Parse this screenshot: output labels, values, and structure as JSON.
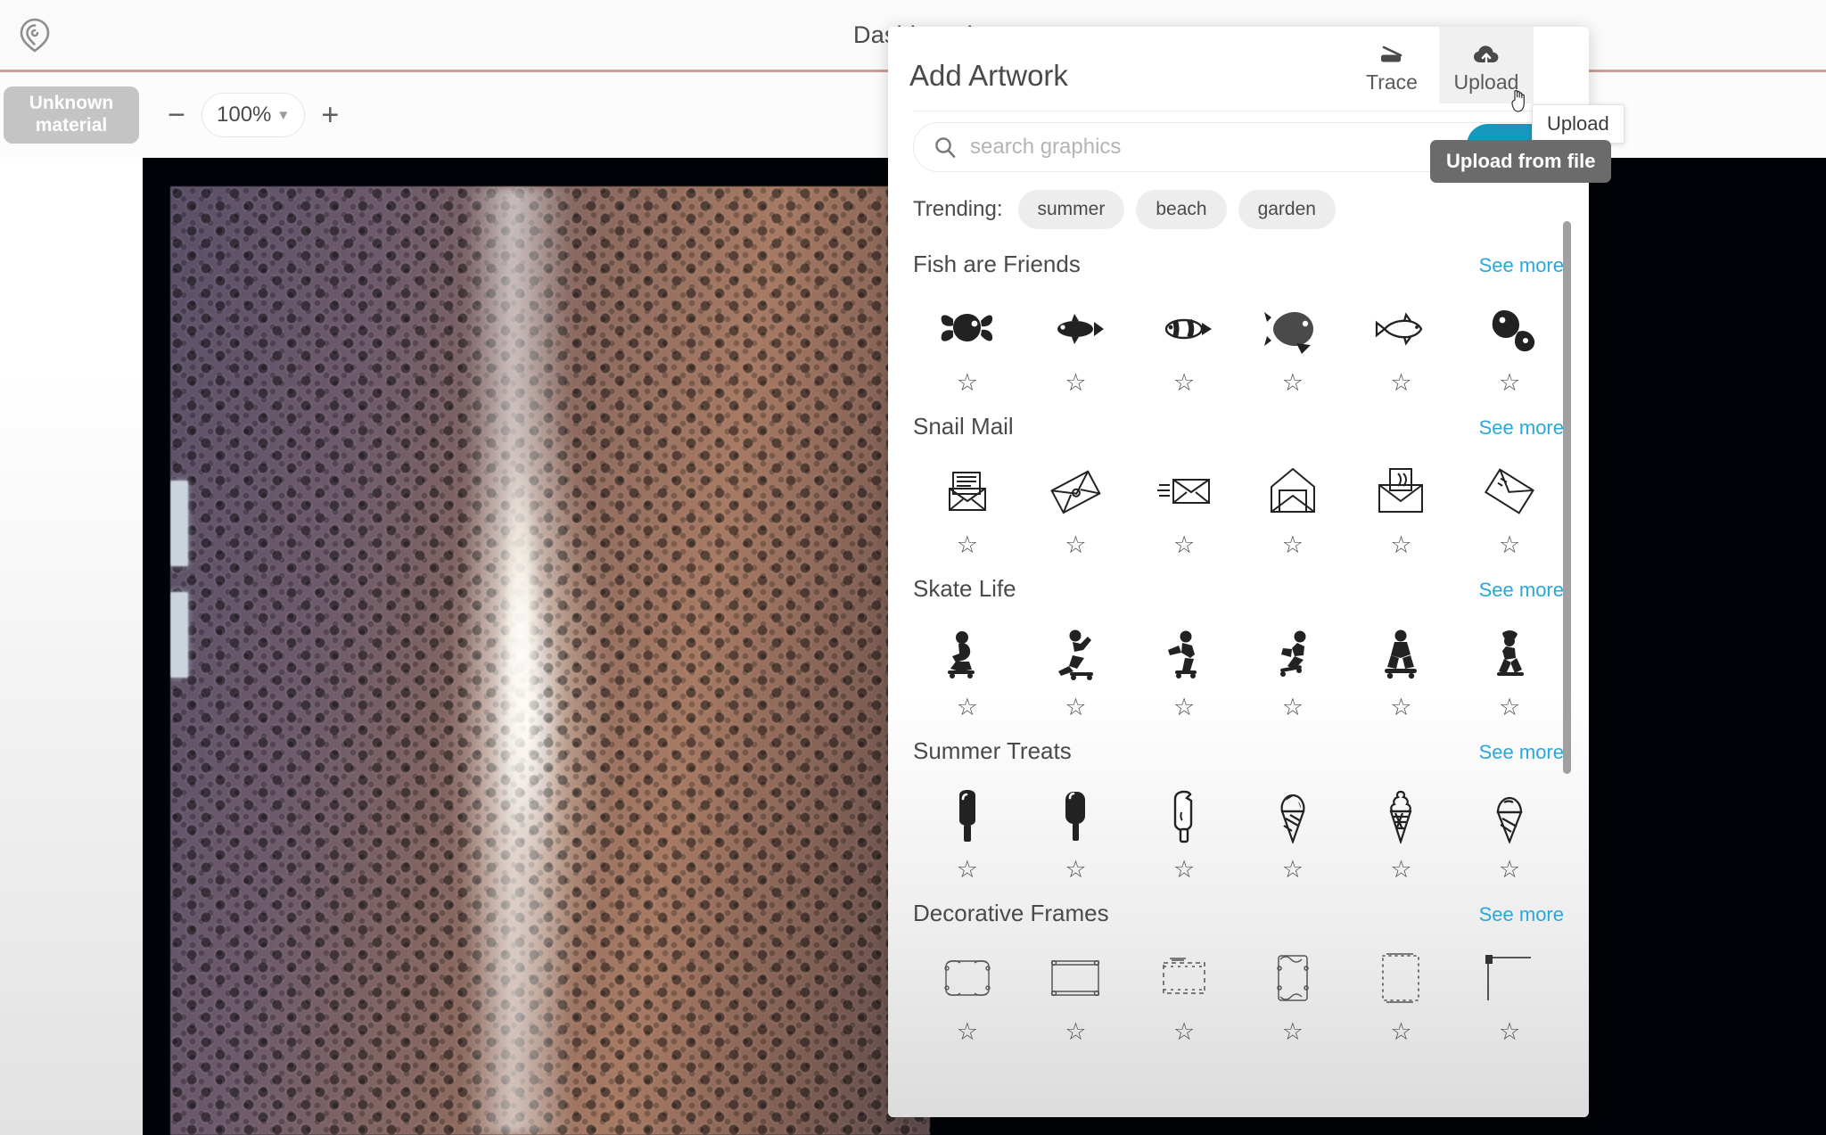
{
  "app": {
    "logo_icon": "glowforge-pin-logo",
    "title": "Dashboard"
  },
  "toolbar": {
    "material_label_line1": "Unknown",
    "material_label_line2": "material",
    "zoom_out_label": "−",
    "zoom_in_label": "+",
    "zoom_value": "100%",
    "zoom_chevron": "⌄"
  },
  "panel": {
    "title": "Add Artwork",
    "actions": [
      {
        "label": "Trace",
        "icon": "scanner-icon",
        "active": false
      },
      {
        "label": "Upload",
        "icon": "cloud-upload-icon",
        "active": true
      }
    ],
    "search": {
      "icon": "search-icon",
      "value": "",
      "placeholder": "search graphics"
    },
    "trending": {
      "label": "Trending:",
      "chips": [
        "summer",
        "beach",
        "garden"
      ]
    },
    "see_more_label": "See more",
    "star_glyph": "☆",
    "sections": [
      {
        "title": "Fish are Friends",
        "items": [
          "goldfish-fancy-icon",
          "fish-dark-side-icon",
          "clownfish-icon",
          "bass-fish-icon",
          "minnow-fish-icon",
          "koi-pair-icon"
        ]
      },
      {
        "title": "Snail Mail",
        "items": [
          "letter-in-envelope-icon",
          "tilted-letter-icon",
          "mail-stack-icon",
          "open-envelope-icon",
          "envelope-with-card-icon",
          "diagonal-envelope-icon"
        ]
      },
      {
        "title": "Skate Life",
        "items": [
          "skater-crouch-icon",
          "skater-push-icon",
          "skater-trick-icon",
          "skater-grab-icon",
          "skater-sit-icon",
          "skater-jump-icon"
        ]
      },
      {
        "title": "Summer Treats",
        "items": [
          "popsicle-solid-icon",
          "popsicle-bar-icon",
          "popsicle-bite-icon",
          "ice-cream-cone-icon",
          "soft-serve-cone-icon",
          "gelato-cone-icon"
        ]
      },
      {
        "title": "Decorative Frames",
        "items": [
          "frame-rounded-icon",
          "frame-square-icon",
          "frame-dashed-icon",
          "frame-tall-icon",
          "frame-dotted-icon",
          "frame-corner-icon"
        ]
      }
    ],
    "scrollbar": "vertical-scrollbar"
  },
  "tooltips": {
    "upload_button": "Upload",
    "upload_from_file": "Upload from file"
  },
  "colors": {
    "accent_rule": "#f3b9ab",
    "link": "#29a8d8",
    "teal_button": "#1697bd",
    "chip_bg": "#ededed",
    "material_chip_bg": "#c4c4c4",
    "tooltip_dark_bg": "#6b6b6b"
  }
}
